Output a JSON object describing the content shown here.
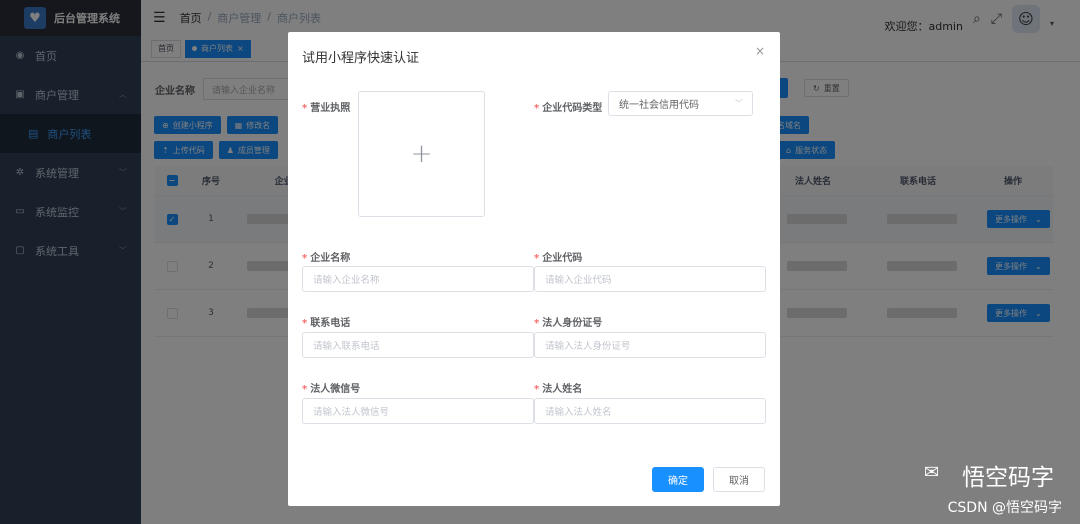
{
  "app": {
    "title": "后台管理系统"
  },
  "sidebar": {
    "items": [
      {
        "label": "首页",
        "icon": "dashboard-icon"
      },
      {
        "label": "商户管理",
        "icon": "merchant-icon"
      },
      {
        "label": "系统管理",
        "icon": "gear-icon"
      },
      {
        "label": "系统监控",
        "icon": "monitor-icon"
      },
      {
        "label": "系统工具",
        "icon": "tools-icon"
      }
    ],
    "active_sub": "商户列表"
  },
  "breadcrumb": [
    "首页",
    "商户管理",
    "商户列表"
  ],
  "header": {
    "welcome": "欢迎您：admin"
  },
  "tags": [
    "首页",
    "商户列表"
  ],
  "search": {
    "label": "企业名称",
    "placeholder": "请输入企业名称",
    "reset_label": "重置"
  },
  "toolbar": {
    "row1": [
      "创建小程序",
      "修改名"
    ],
    "row1_right": "名域名",
    "row2": [
      "上传代码",
      "成员管理"
    ],
    "row2_right": "服务状态"
  },
  "table": {
    "headers": {
      "no": "序号",
      "name": "企业名",
      "legal": "法人姓名",
      "phone": "联系电话",
      "op": "操作"
    },
    "rows": [
      {
        "no": "1",
        "checked": true,
        "op_label": "更多操作"
      },
      {
        "no": "2",
        "checked": false,
        "op_label": "更多操作"
      },
      {
        "no": "3",
        "checked": false,
        "op_label": "更多操作"
      }
    ]
  },
  "dialog": {
    "title": "试用小程序快速认证",
    "close": "×",
    "license_label": "营业执照",
    "code_type_label": "企业代码类型",
    "code_type_value": "统一社会信用代码",
    "fields": {
      "company_name": {
        "label": "企业名称",
        "placeholder": "请输入企业名称"
      },
      "company_code": {
        "label": "企业代码",
        "placeholder": "请输入企业代码"
      },
      "phone": {
        "label": "联系电话",
        "placeholder": "请输入联系电话"
      },
      "legal_id": {
        "label": "法人身份证号",
        "placeholder": "请输入法人身份证号"
      },
      "legal_wechat": {
        "label": "法人微信号",
        "placeholder": "请输入法人微信号"
      },
      "legal_name": {
        "label": "法人姓名",
        "placeholder": "请输入法人姓名"
      }
    },
    "confirm_label": "确定",
    "cancel_label": "取消"
  },
  "watermark": {
    "brand": "悟空码字",
    "source": "CSDN @悟空码字"
  }
}
